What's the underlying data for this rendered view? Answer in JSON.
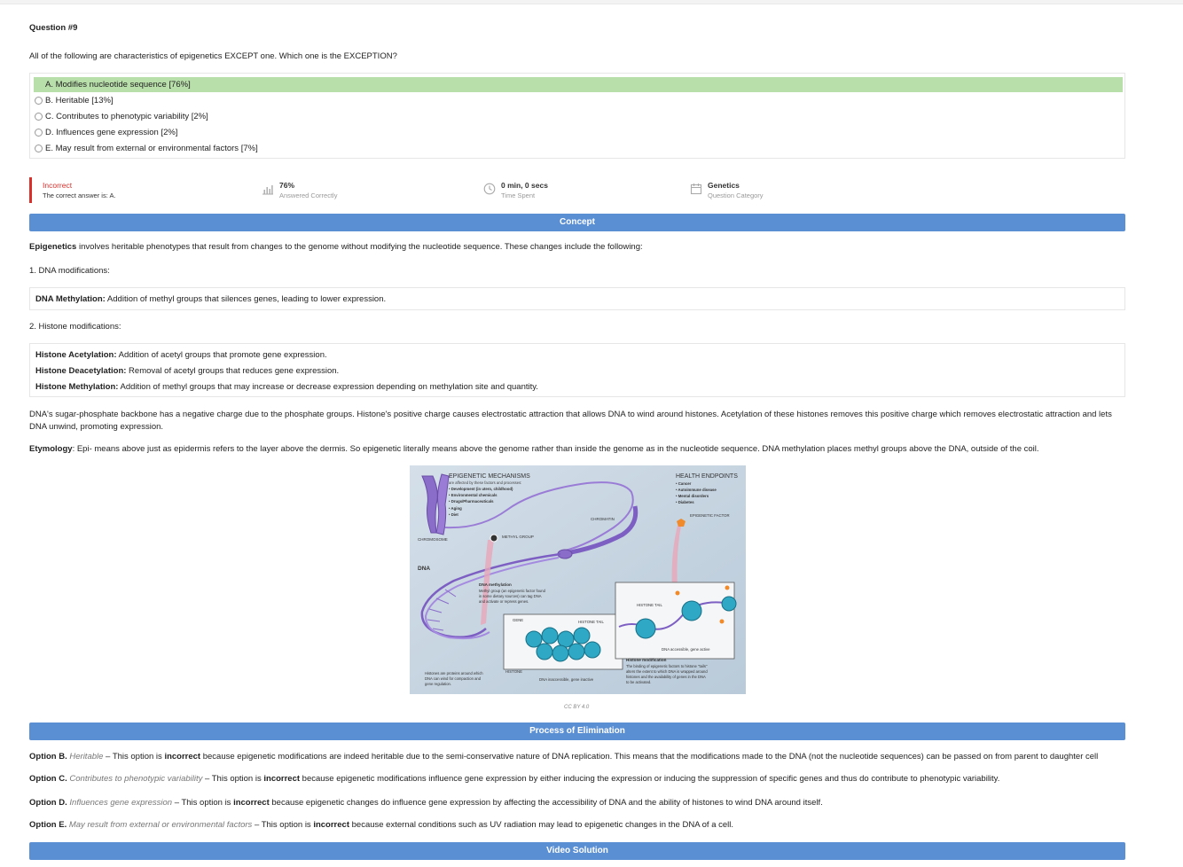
{
  "question": {
    "number": "Question #9",
    "text": "All of the following are characteristics of epigenetics EXCEPT one. Which one is the EXCEPTION?"
  },
  "options": [
    {
      "label": "A. Modifies nucleotide sequence [76%]",
      "correct": true
    },
    {
      "label": "B. Heritable [13%]",
      "correct": false
    },
    {
      "label": "C. Contributes to phenotypic variability [2%]",
      "correct": false
    },
    {
      "label": "D. Influences gene expression [2%]",
      "correct": false
    },
    {
      "label": "E. May result from external or environmental factors [7%]",
      "correct": false
    }
  ],
  "result": {
    "status": "Incorrect",
    "correct_answer": "The correct answer is: A.",
    "status_color": "#d9302c",
    "answered_value": "76%",
    "answered_label": "Answered Correctly",
    "time_value": "0 min, 0 secs",
    "time_label": "Time Spent",
    "category_value": "Genetics",
    "category_label": "Question Category"
  },
  "sections": {
    "concept": "Concept",
    "elimination": "Process of Elimination",
    "video": "Video Solution"
  },
  "concept": {
    "intro_bold": "Epigenetics",
    "intro_rest": " involves heritable phenotypes that result from changes to the genome without modifying the nucleotide sequence. These changes include the following:",
    "dna_heading": "1. DNA modifications:",
    "dna_methylation_bold": "DNA Methylation:",
    "dna_methylation_text": " Addition of methyl groups that silences genes, leading to lower expression.",
    "histone_heading": "2. Histone modifications:",
    "histone_acetylation_bold": "Histone Acetylation:",
    "histone_acetylation_text": " Addition of acetyl groups that promote gene expression.",
    "histone_deacetylation_bold": "Histone Deacetylation:",
    "histone_deacetylation_text": " Removal of acetyl groups that reduces gene expression.",
    "histone_methylation_bold": "Histone Methylation:",
    "histone_methylation_text": " Addition of methyl groups that may increase or decrease expression depending on methylation site and quantity.",
    "charge_para": "DNA's sugar-phosphate backbone has a negative charge due to the phosphate groups. Histone's positive charge causes electrostatic attraction that allows DNA to wind around histones. Acetylation of these histones removes this positive charge which removes electrostatic attraction and lets DNA unwind, promoting expression.",
    "etymology_bold": "Etymology",
    "etymology_text": ": Epi- means above just as epidermis refers to the layer above the dermis. So epigenetic literally means above the genome rather than inside the genome as in the nucleotide sequence. DNA methylation places methyl groups above the DNA, outside of the coil."
  },
  "figure": {
    "title": "EPIGENETIC MECHANISMS",
    "subtitle": "are affected by these factors and processes:",
    "factors": [
      "• Development (in utero, childhood)",
      "• Environmental chemicals",
      "• Drugs/Pharmaceuticals",
      "• Aging",
      "• Diet"
    ],
    "health_title": "HEALTH ENDPOINTS",
    "health": [
      "• Cancer",
      "• Autoimmune disease",
      "• Mental disorders",
      "• Diabetes"
    ],
    "epigenetic_factor": "EPIGENETIC FACTOR",
    "chromatin": "CHROMATIN",
    "chromosome": "CHROMOSOME",
    "methyl_group": "METHYL GROUP",
    "dna": "DNA",
    "dna_methylation_title": "DNA methylation",
    "dna_methylation_desc": [
      "Methyl group (an epigenetic factor found",
      "in some dietary sources) can tag DNA",
      "and activate or repress genes."
    ],
    "histone_tail": "HISTONE TAIL",
    "gene": "GENE",
    "histone": "HISTONE",
    "dna_accessible": "DNA accessible, gene active",
    "dna_inaccessible": "DNA inaccessible, gene inactive",
    "histone_desc": [
      "Histones are proteins around which",
      "DNA can wind for compaction and",
      "gene regulation."
    ],
    "histone_mod_title": "Histone modification",
    "histone_mod_desc": [
      "The binding of epigenetic factors to histone \"tails\"",
      "alters the extent to which DNA is wrapped around",
      "histones and the availability of genes in the DNA",
      "to be activated."
    ],
    "credit": "CC BY 4.0"
  },
  "elimination": [
    {
      "label": "Option B.",
      "option": "Heritable",
      "pre": " – This option is ",
      "verdict": "incorrect",
      "post": " because epigenetic modifications are indeed heritable due to the semi-conservative nature of DNA replication. This means that the modifications made to the DNA (not the nucleotide sequences) can be passed on from parent to daughter cell"
    },
    {
      "label": "Option C.",
      "option": "Contributes to phenotypic variability",
      "pre": " – This option is ",
      "verdict": "incorrect",
      "post": " because epigenetic modifications influence gene expression by either inducing the expression or inducing the suppression of specific genes and thus do contribute to phenotypic variability."
    },
    {
      "label": "Option D.",
      "option": "Influences gene expression",
      "pre": " – This option is ",
      "verdict": "incorrect",
      "post": " because epigenetic changes do influence gene expression by affecting the accessibility of DNA and the ability of histones to wind DNA around itself."
    },
    {
      "label": "Option E.",
      "option": "May result from external or environmental factors",
      "pre": " – This option is ",
      "verdict": "incorrect",
      "post": " because external conditions such as UV radiation may lead to epigenetic changes in the DNA of a cell."
    }
  ]
}
